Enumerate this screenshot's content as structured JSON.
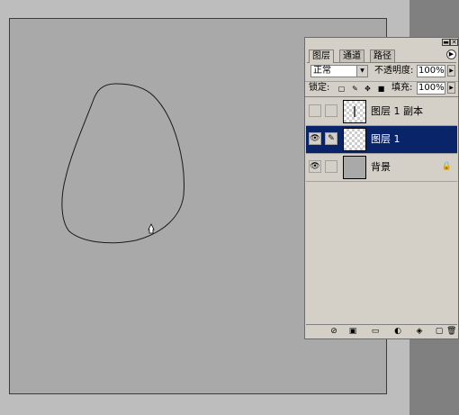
{
  "canvas": {
    "shape": "closed freehand path outline"
  },
  "layers_panel": {
    "tabs": [
      {
        "label": "图层",
        "active": true
      },
      {
        "label": "通道",
        "active": false
      },
      {
        "label": "路径",
        "active": false
      }
    ],
    "blend_mode": "正常",
    "opacity_label": "不透明度:",
    "opacity_value": "100%",
    "lock_label": "锁定:",
    "fill_label": "填充:",
    "fill_value": "100%",
    "layers": [
      {
        "name": "图层 1 副本",
        "visible": false,
        "selected": false
      },
      {
        "name": "图层 1",
        "visible": true,
        "selected": true
      },
      {
        "name": "背景",
        "visible": true,
        "selected": false,
        "locked": true
      }
    ]
  },
  "colors": {
    "selection": "#0a246a",
    "panel_bg": "#d4d0c8",
    "canvas_bg": "#a9a9a9"
  }
}
